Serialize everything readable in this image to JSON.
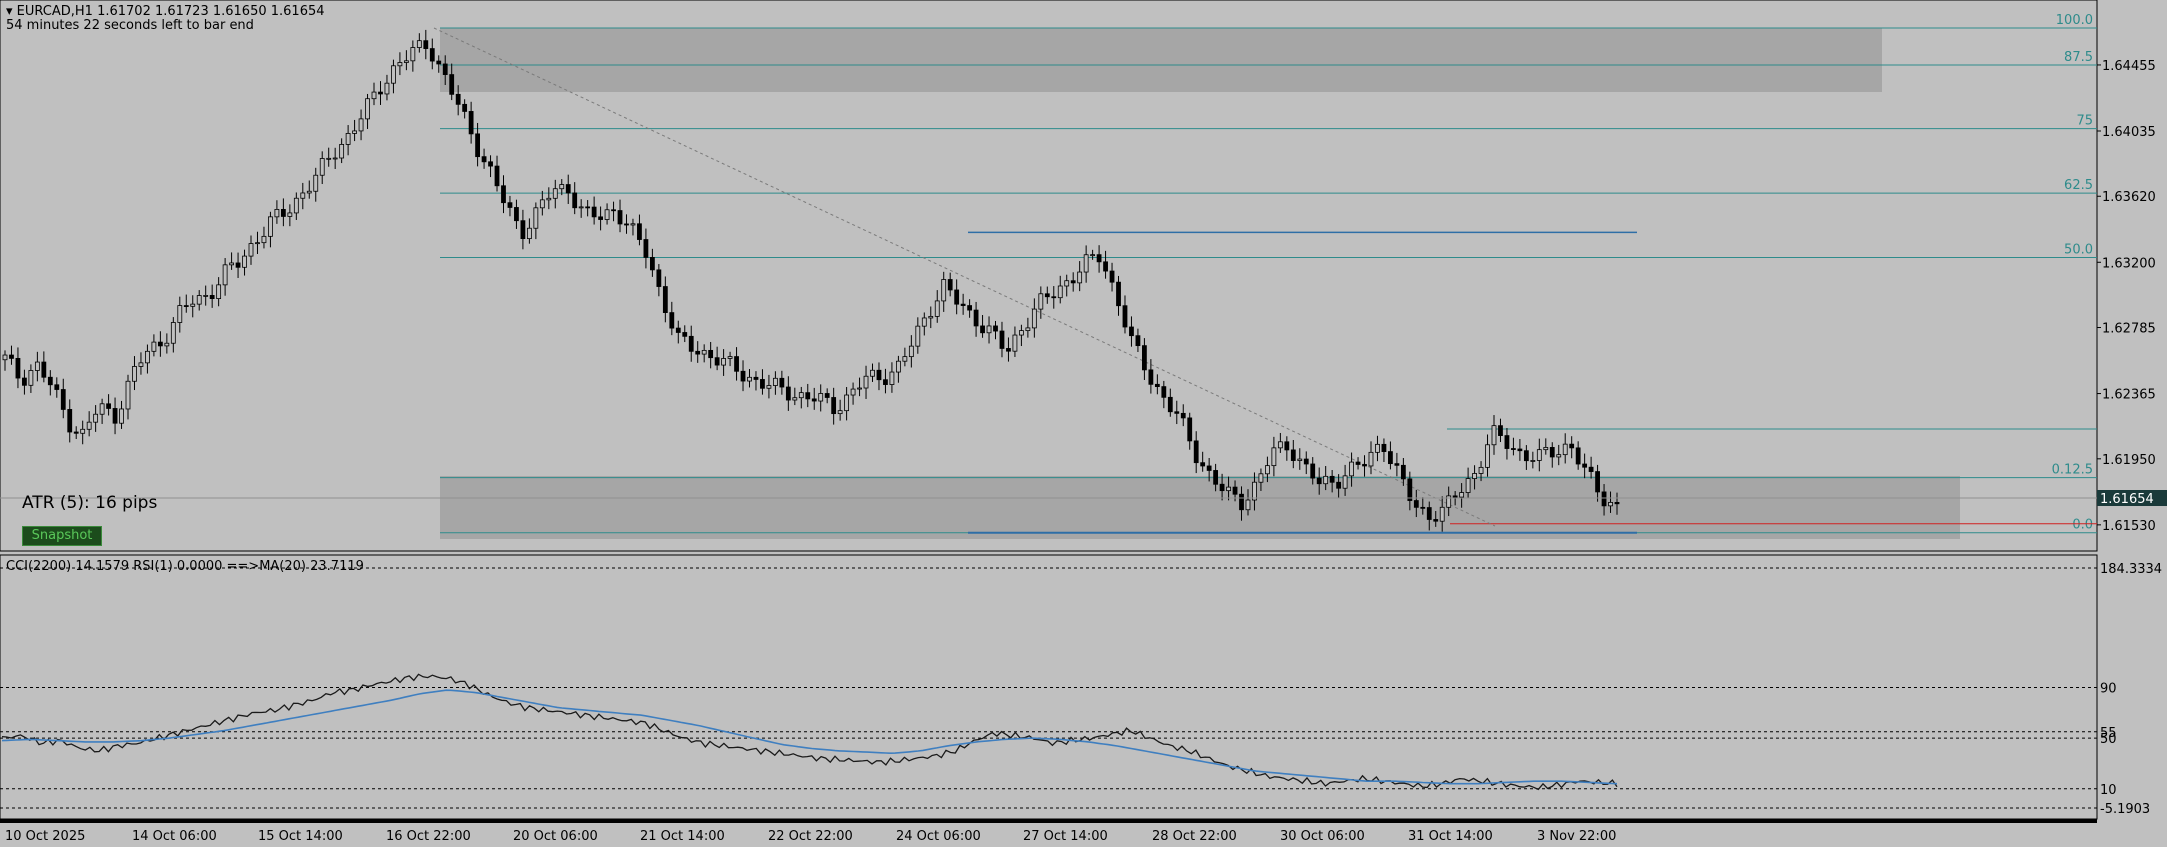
{
  "header": {
    "symbol_line": "EURCAD,H1  1.61702 1.61723 1.61650 1.61654",
    "bar_timer": "54 minutes 22 seconds left to bar end"
  },
  "atr_label": "ATR (5): 16 pips",
  "button_label": "Snapshot",
  "price_axis": {
    "labels": [
      "1.64455",
      "1.64035",
      "1.63620",
      "1.63200",
      "1.62785",
      "1.62365",
      "1.61950",
      "1.61530"
    ],
    "current_price": "1.61654"
  },
  "fib_levels": [
    "100.0",
    "87.5",
    "75",
    "62.5",
    "50.0",
    "0.12.5",
    "0.0"
  ],
  "indicator": {
    "header": "CCI(2200) 14.1579  RSI(1) 0.0000  ==>MA(20) 23.7119",
    "axis_labels": [
      "184.3334",
      "90",
      "55",
      "50",
      "10",
      "-5.1903"
    ]
  },
  "time_axis": [
    "10 Oct 2025",
    "14 Oct 06:00",
    "15 Oct 14:00",
    "16 Oct 22:00",
    "20 Oct 06:00",
    "21 Oct 14:00",
    "22 Oct 22:00",
    "24 Oct 06:00",
    "27 Oct 14:00",
    "28 Oct 22:00",
    "30 Oct 06:00",
    "31 Oct 14:00",
    "3 Nov 22:00"
  ],
  "colors": {
    "background": "#c0c0c0",
    "fib_line": "#2e8b8b",
    "zone_fill": "#a6a6a6",
    "blue_line": "#2e6ea6",
    "ma_line": "#3f7fc0",
    "price_tag": "#1a3a3a",
    "red_line": "#d02020"
  },
  "chart_data": [
    {
      "type": "candlestick",
      "title": "EURCAD,H1",
      "ylim": [
        1.6144,
        1.6469
      ],
      "x_ticks": [
        "10 Oct 2025",
        "14 Oct 06:00",
        "15 Oct 14:00",
        "16 Oct 22:00",
        "20 Oct 06:00",
        "21 Oct 14:00",
        "22 Oct 22:00",
        "24 Oct 06:00",
        "27 Oct 14:00",
        "28 Oct 22:00",
        "30 Oct 06:00",
        "31 Oct 14:00",
        "3 Nov 22:00"
      ],
      "y_ticks": [
        1.64455,
        1.64035,
        1.6362,
        1.632,
        1.62785,
        1.62365,
        1.6195,
        1.6153
      ],
      "close_path": [
        1.6258,
        1.6246,
        1.6255,
        1.624,
        1.622,
        1.621,
        1.6228,
        1.6222,
        1.6245,
        1.6262,
        1.627,
        1.6285,
        1.6295,
        1.63,
        1.6312,
        1.632,
        1.6335,
        1.6345,
        1.6352,
        1.6365,
        1.6375,
        1.639,
        1.6402,
        1.6415,
        1.6432,
        1.6446,
        1.6452,
        1.646,
        1.644,
        1.6418,
        1.6398,
        1.6378,
        1.6355,
        1.634,
        1.6352,
        1.6365,
        1.6368,
        1.635,
        1.6348,
        1.6355,
        1.634,
        1.6325,
        1.6298,
        1.627,
        1.6265,
        1.6262,
        1.6255,
        1.625,
        1.6245,
        1.624,
        1.6238,
        1.6235,
        1.6232,
        1.6228,
        1.6236,
        1.6245,
        1.6248,
        1.6252,
        1.6268,
        1.629,
        1.6305,
        1.6292,
        1.6285,
        1.6275,
        1.6262,
        1.628,
        1.6292,
        1.63,
        1.631,
        1.6318,
        1.6324,
        1.63,
        1.6268,
        1.625,
        1.6235,
        1.622,
        1.62,
        1.6185,
        1.6172,
        1.6168,
        1.618,
        1.6198,
        1.6205,
        1.619,
        1.6178,
        1.6182,
        1.6188,
        1.6192,
        1.6208,
        1.6185,
        1.6165,
        1.616,
        1.6162,
        1.6175,
        1.6188,
        1.621,
        1.6205,
        1.6198,
        1.6195,
        1.62,
        1.6205,
        1.6185,
        1.6172,
        1.6165
      ],
      "current_price": 1.61654,
      "fib_retracement": [
        {
          "label": "100.0",
          "price": 1.6469
        },
        {
          "label": "87.5",
          "price": 1.64455
        },
        {
          "label": "75",
          "price": 1.6405
        },
        {
          "label": "62.5",
          "price": 1.6364
        },
        {
          "label": "50.0",
          "price": 1.6323
        },
        {
          "label": "0.12.5",
          "price": 1.6183
        },
        {
          "label": "0.0",
          "price": 1.6148
        }
      ],
      "resistance_levels": [
        1.6339,
        1.6214
      ],
      "support_level": 1.6148,
      "grid": false
    },
    {
      "type": "line",
      "title": "CCI(2200) 14.1579  RSI(1) 0.0000  ==>MA(20) 23.7119",
      "ylim": [
        -5.1903,
        184.3334
      ],
      "levels": [
        90,
        55,
        50,
        10
      ],
      "series": [
        {
          "name": "CCI(2200)",
          "values": [
            50,
            52,
            46,
            48,
            42,
            40,
            44,
            46,
            50,
            54,
            58,
            62,
            66,
            70,
            72,
            76,
            80,
            86,
            88,
            92,
            95,
            98,
            99,
            97,
            92,
            84,
            78,
            74,
            72,
            70,
            68,
            66,
            64,
            62,
            56,
            50,
            46,
            44,
            42,
            40,
            38,
            36,
            34,
            33,
            32,
            31,
            32,
            34,
            36,
            40,
            48,
            54,
            52,
            50,
            46,
            48,
            50,
            53,
            56,
            50,
            44,
            40,
            34,
            28,
            24,
            20,
            18,
            16,
            14,
            16,
            18,
            16,
            14,
            12,
            14,
            18,
            16,
            14,
            12,
            11,
            13,
            16,
            15,
            14
          ]
        },
        {
          "name": "MA(20)",
          "values": [
            48,
            49,
            48,
            47,
            47,
            48,
            50,
            53,
            56,
            60,
            64,
            68,
            72,
            76,
            80,
            85,
            88,
            86,
            82,
            78,
            74,
            72,
            70,
            68,
            64,
            60,
            55,
            50,
            45,
            42,
            40,
            39,
            38,
            40,
            44,
            47,
            49,
            50,
            49,
            47,
            44,
            40,
            36,
            32,
            28,
            24,
            22,
            20,
            18,
            16,
            16,
            15,
            14,
            14,
            15,
            16,
            16,
            15,
            14
          ]
        }
      ],
      "grid": false
    }
  ]
}
